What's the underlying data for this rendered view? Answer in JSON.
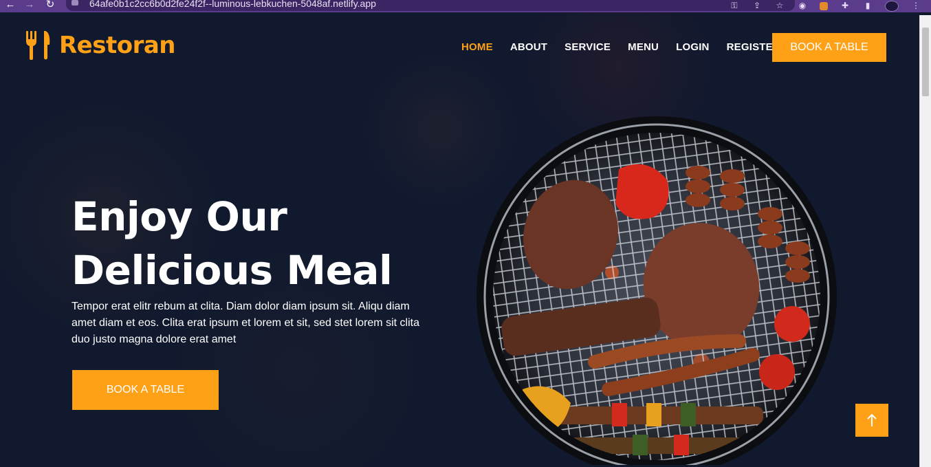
{
  "browser": {
    "url": "64afe0b1c2cc6b0d2fe24f2f--luminous-lebkuchen-5048af.netlify.app"
  },
  "brand": {
    "name": "Restoran"
  },
  "nav": {
    "items": [
      {
        "label": "HOME",
        "active": true
      },
      {
        "label": "ABOUT",
        "active": false
      },
      {
        "label": "SERVICE",
        "active": false
      },
      {
        "label": "MENU",
        "active": false
      },
      {
        "label": "LOGIN",
        "active": false
      },
      {
        "label": "REGISTER",
        "active": false
      }
    ],
    "cta_label": "BOOK A TABLE"
  },
  "hero": {
    "title_line1": "Enjoy Our",
    "title_line2": "Delicious Meal",
    "text": "Tempor erat elitr rebum at clita. Diam dolor diam ipsum sit. Aliqu diam amet diam et eos. Clita erat ipsum et lorem et sit, sed stet lorem sit clita duo justo magna dolore erat amet",
    "cta_label": "BOOK A TABLE"
  },
  "back_to_top": {
    "icon": "arrow-up-icon"
  },
  "colors": {
    "accent": "#fea116",
    "dark_bg": "#0f172b",
    "browser_frame": "#5b3b8c"
  }
}
